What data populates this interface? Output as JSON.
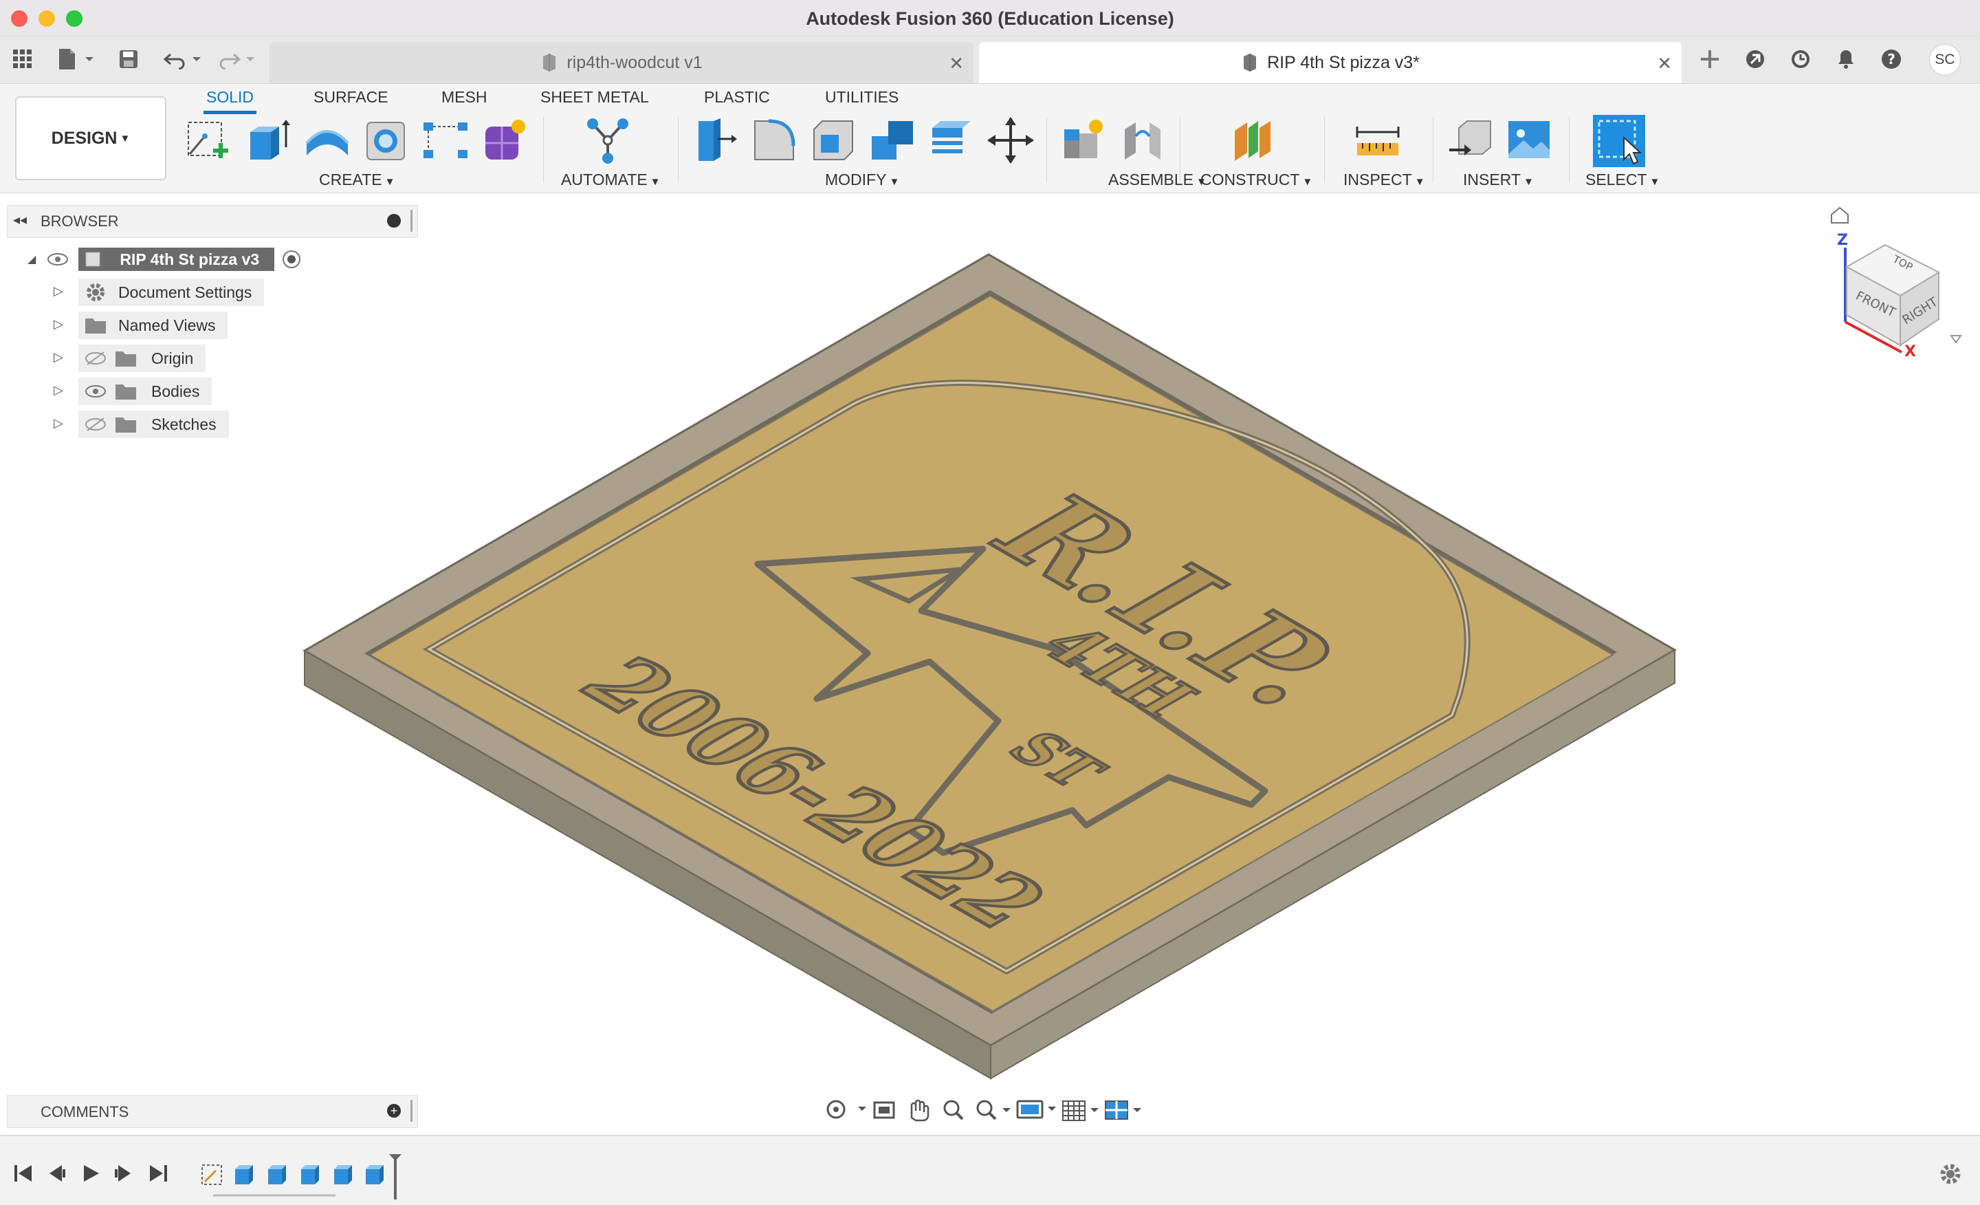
{
  "window": {
    "title": "Autodesk Fusion 360 (Education License)",
    "traffic_lights": [
      "#fe5f57",
      "#febc2e",
      "#28c840"
    ]
  },
  "tabs": [
    {
      "label": "rip4th-woodcut v1",
      "active": false
    },
    {
      "label": "RIP 4th St pizza v3*",
      "active": true
    }
  ],
  "header_right": {
    "avatar_initials": "SC"
  },
  "toolbar": {
    "workspace": "DESIGN",
    "workspace_tabs": [
      "SOLID",
      "SURFACE",
      "MESH",
      "SHEET METAL",
      "PLASTIC",
      "UTILITIES"
    ],
    "groups": {
      "create": "CREATE",
      "automate": "AUTOMATE",
      "modify": "MODIFY",
      "assemble": "ASSEMBLE",
      "construct": "CONSTRUCT",
      "inspect": "INSPECT",
      "insert": "INSERT",
      "select": "SELECT"
    },
    "accent": "#0d76c8"
  },
  "browser": {
    "title": "BROWSER",
    "root": "RIP 4th St pizza v3",
    "items": [
      {
        "label": "Document Settings",
        "icon": "gear-icon",
        "visibility": "none"
      },
      {
        "label": "Named Views",
        "icon": "folder-icon",
        "visibility": "none"
      },
      {
        "label": "Origin",
        "icon": "folder-icon",
        "visibility": "hidden"
      },
      {
        "label": "Bodies",
        "icon": "folder-icon",
        "visibility": "visible"
      },
      {
        "label": "Sketches",
        "icon": "folder-icon",
        "visibility": "hidden"
      }
    ]
  },
  "comments": {
    "title": "COMMENTS"
  },
  "viewcube": {
    "faces": [
      "TOP",
      "FRONT",
      "RIGHT"
    ],
    "axes": [
      "Z",
      "X"
    ]
  },
  "model": {
    "texts": [
      "R.I.P.",
      "4TH",
      "ST",
      "2006-2022"
    ],
    "colors": {
      "plaque": "#c6a969",
      "frame": "#a59c8a",
      "edge": "#7a7466"
    }
  }
}
